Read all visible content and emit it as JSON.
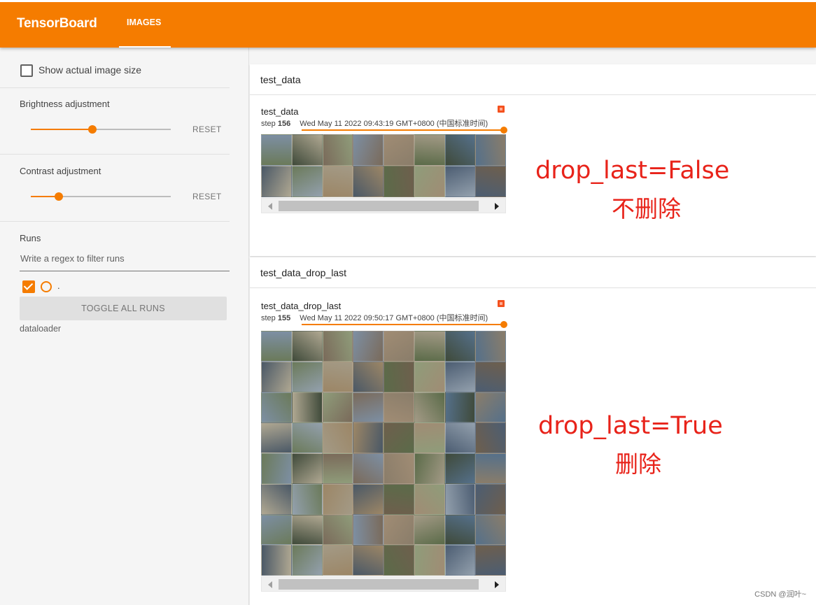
{
  "app": {
    "title": "TensorBoard",
    "active_tab": "IMAGES"
  },
  "sidebar": {
    "show_actual_size_label": "Show actual image size",
    "brightness": {
      "label": "Brightness adjustment",
      "value_fraction": 0.44,
      "reset": "RESET"
    },
    "contrast": {
      "label": "Contrast adjustment",
      "value_fraction": 0.2,
      "reset": "RESET"
    },
    "runs": {
      "heading": "Runs",
      "filter_placeholder": "Write a regex to filter runs",
      "dot_label": ".",
      "toggle_all": "TOGGLE ALL RUNS",
      "run_name": "dataloader"
    }
  },
  "groups": [
    {
      "header": "test_data",
      "card": {
        "title": "test_data",
        "step_label": "step",
        "step_value": "156",
        "timestamp": "Wed May 11 2022 09:43:19 GMT+0800 (中国标准时间)"
      }
    },
    {
      "header": "test_data_drop_last",
      "card": {
        "title": "test_data_drop_last",
        "step_label": "step",
        "step_value": "155",
        "timestamp": "Wed May 11 2022 09:50:17 GMT+0800 (中国标准时间)"
      }
    }
  ],
  "annotations": {
    "false_label": "drop_last=False",
    "false_cn": "不删除",
    "true_label": "drop_last=True",
    "true_cn": "删除"
  },
  "watermark": "CSDN @润叶~",
  "colors": {
    "accent": "#f57c00",
    "annotation": "#e8231a"
  }
}
